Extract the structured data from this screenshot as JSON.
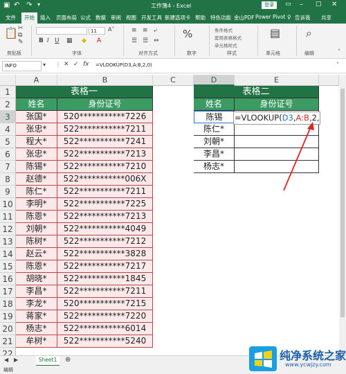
{
  "window": {
    "title": "工作簿4 - Excel",
    "login_label": "登录"
  },
  "tabs": [
    "文件",
    "开始",
    "插入",
    "页面布局",
    "公式",
    "数据",
    "审阅",
    "视图",
    "开发工具",
    "新建选项卡",
    "帮助",
    "特色功能",
    "金山PDF",
    "Power Pivot",
    "告诉我",
    "共享"
  ],
  "active_tab": "开始",
  "ribbon": {
    "groups": [
      "剪贴板",
      "字体",
      "对齐方式",
      "数字",
      "样式",
      "单元格",
      "编辑"
    ],
    "font_size": "11",
    "styles_items": [
      "条件格式",
      "套用表格格式",
      "单元格样式"
    ]
  },
  "formula_bar": {
    "name_box": "INFO",
    "formula": "=VLOOKUP(D3,A:B,2,0)"
  },
  "columns": [
    "A",
    "B",
    "C",
    "D",
    "E"
  ],
  "rows": [
    "1",
    "2",
    "3",
    "4",
    "5",
    "6",
    "7",
    "8",
    "9",
    "10",
    "11",
    "12",
    "13",
    "14",
    "15",
    "16",
    "17",
    "18",
    "19",
    "20",
    "21",
    "22"
  ],
  "table1": {
    "title": "表格一",
    "headers": [
      "姓名",
      "身份证号"
    ],
    "rows": [
      [
        "张国*",
        "520***********7226"
      ],
      [
        "张忠*",
        "522***********7211"
      ],
      [
        "程大*",
        "522***********7241"
      ],
      [
        "张忠*",
        "522***********7213"
      ],
      [
        "陈锡*",
        "522***********7210"
      ],
      [
        "赵德*",
        "522***********006X"
      ],
      [
        "陈仁*",
        "522***********7211"
      ],
      [
        "李明*",
        "522***********7225"
      ],
      [
        "陈恩*",
        "522***********7213"
      ],
      [
        "刘朝*",
        "522***********4049"
      ],
      [
        "陈树*",
        "522***********7212"
      ],
      [
        "赵云*",
        "522***********3828"
      ],
      [
        "陈恩*",
        "522***********7217"
      ],
      [
        "胡晓*",
        "522***********1845"
      ],
      [
        "李昌*",
        "522***********7211"
      ],
      [
        "李龙*",
        "520***********7215"
      ],
      [
        "蒋家*",
        "522***********7220"
      ],
      [
        "杨志*",
        "522***********6014"
      ],
      [
        "牟树*",
        "522***********5240"
      ]
    ]
  },
  "table2": {
    "title": "表格二",
    "headers": [
      "姓名",
      "身份证号"
    ],
    "names": [
      "陈锡",
      "陈仁*",
      "刘朝*",
      "李昌*",
      "杨志*"
    ],
    "editing_formula": {
      "prefix": "=VLOOKUP(",
      "ref1": "D3",
      "comma1": ",",
      "ref2": "A:B",
      "suffix": ",2,0)"
    }
  },
  "sheet": {
    "tab": "Sheet1"
  },
  "status": "编辑",
  "watermark": {
    "title": "纯净系统之家",
    "url": "www.ycwjzy.com"
  },
  "colors": {
    "excel_green": "#217346",
    "header_green": "#3c9a63",
    "pink_fill": "#fde9ea",
    "ref_blue": "#2f6fd0",
    "ref_red": "#c0392b",
    "arrow": "#e02020"
  }
}
